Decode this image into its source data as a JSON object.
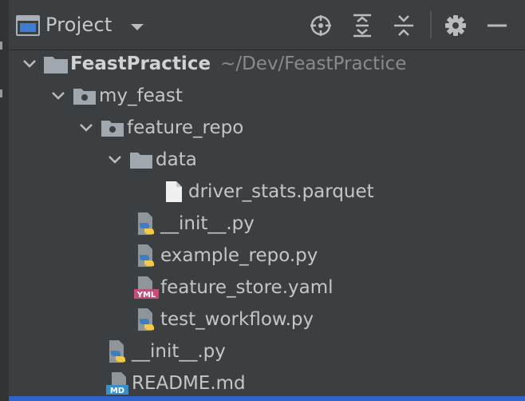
{
  "panel": {
    "title": "Project",
    "view_selector_icon": "chevron-down-icon"
  },
  "toolbar": {
    "icons": [
      "crosshair-icon",
      "expand-all-icon",
      "collapse-all-icon",
      "gear-icon",
      "minimize-icon"
    ],
    "accent": "#bbbbbb"
  },
  "tree": {
    "root": {
      "name": "FeastPractice",
      "path": "~/Dev/FeastPractice"
    },
    "items": [
      {
        "label": "my_feast",
        "icon": "module-folder-icon"
      },
      {
        "label": "feature_repo",
        "icon": "module-folder-icon"
      },
      {
        "label": "data",
        "icon": "folder-icon"
      },
      {
        "label": "driver_stats.parquet",
        "icon": "file-icon"
      },
      {
        "label": "__init__.py",
        "icon": "python-file-icon"
      },
      {
        "label": "example_repo.py",
        "icon": "python-file-icon"
      },
      {
        "label": "feature_store.yaml",
        "icon": "yaml-file-icon",
        "badge": "YML"
      },
      {
        "label": "test_workflow.py",
        "icon": "python-file-icon"
      },
      {
        "label": "__init__.py",
        "icon": "python-file-icon"
      },
      {
        "label": "README.md",
        "icon": "markdown-file-icon",
        "badge": "MD"
      }
    ]
  },
  "colors": {
    "background": "#3c3f41",
    "text": "#c5c5c5",
    "path_text": "#8a8a8a",
    "folder": "#a0a7ae",
    "python_blue": "#3f7fc0",
    "python_yellow": "#f2c94c",
    "yaml_badge": "#c0507a",
    "md_badge": "#3a8fc9",
    "selection_bar": "#2f65ca"
  }
}
